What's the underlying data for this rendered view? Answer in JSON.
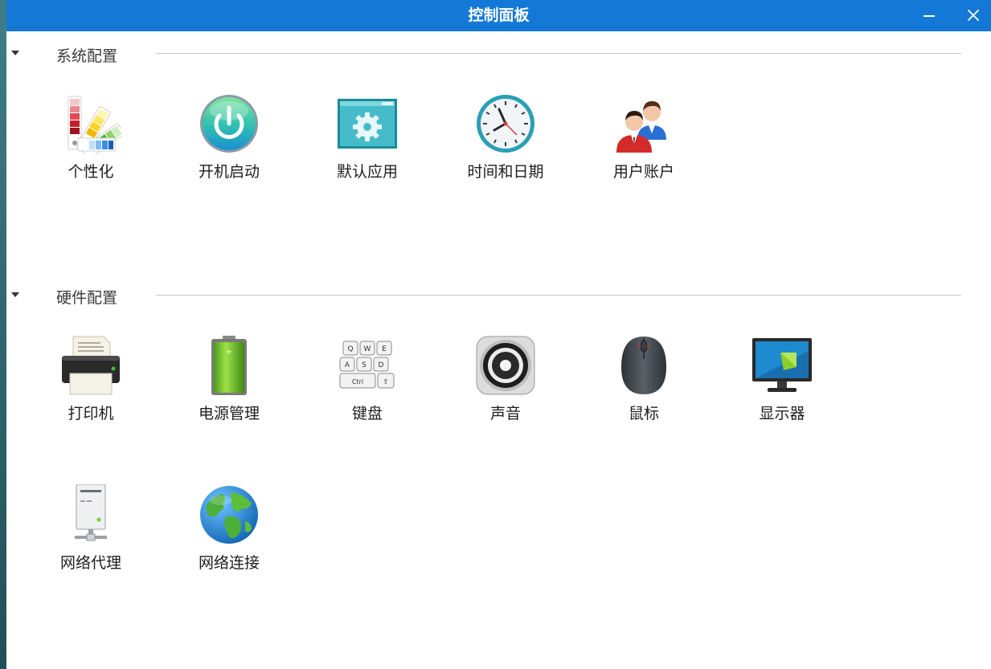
{
  "window": {
    "title": "控制面板"
  },
  "sections": [
    {
      "label": "系统配置",
      "items": [
        {
          "label": "个性化",
          "icon": "color-palette-icon"
        },
        {
          "label": "开机启动",
          "icon": "power-icon"
        },
        {
          "label": "默认应用",
          "icon": "gear-window-icon"
        },
        {
          "label": "时间和日期",
          "icon": "clock-icon"
        },
        {
          "label": "用户账户",
          "icon": "users-icon"
        }
      ]
    },
    {
      "label": "硬件配置",
      "items": [
        {
          "label": "打印机",
          "icon": "printer-icon"
        },
        {
          "label": "电源管理",
          "icon": "battery-icon"
        },
        {
          "label": "键盘",
          "icon": "keyboard-icon"
        },
        {
          "label": "声音",
          "icon": "speaker-icon"
        },
        {
          "label": "鼠标",
          "icon": "mouse-icon"
        },
        {
          "label": "显示器",
          "icon": "monitor-icon"
        },
        {
          "label": "网络代理",
          "icon": "proxy-server-icon"
        },
        {
          "label": "网络连接",
          "icon": "globe-icon"
        }
      ]
    }
  ],
  "keyboard_keys": [
    "Q",
    "W",
    "E",
    "A",
    "S",
    "D",
    "Ctrl",
    "⇧"
  ],
  "colors": {
    "titlebar": "#1479d6",
    "background": "#ffffff",
    "desktop": "#2f6a73"
  }
}
